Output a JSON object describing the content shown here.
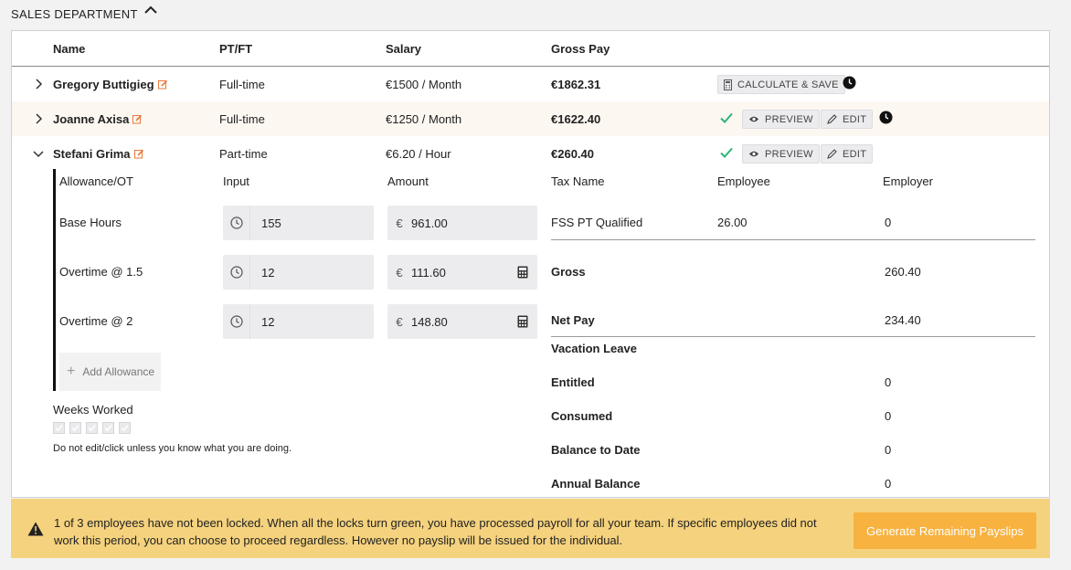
{
  "department": {
    "title": "SALES DEPARTMENT"
  },
  "table": {
    "headers": {
      "name": "Name",
      "type": "PT/FT",
      "salary": "Salary",
      "gross": "Gross Pay"
    },
    "rows": [
      {
        "name": "Gregory Buttigieg",
        "type": "Full-time",
        "salary": "€1500 / Month",
        "gross": "€1862.31",
        "action": "CALCULATE & SAVE"
      },
      {
        "name": "Joanne Axisa",
        "type": "Full-time",
        "salary": "€1250 / Month",
        "gross": "€1622.40",
        "preview": "PREVIEW",
        "edit": "EDIT"
      },
      {
        "name": "Stefani Grima",
        "type": "Part-time",
        "salary": "€6.20 / Hour",
        "gross": "€260.40",
        "preview": "PREVIEW",
        "edit": "EDIT"
      }
    ]
  },
  "detail": {
    "headers": {
      "allowance": "Allowance/OT",
      "input": "Input",
      "amount": "Amount",
      "tax_name": "Tax Name",
      "employee": "Employee",
      "employer": "Employer"
    },
    "allowances": [
      {
        "label": "Base Hours",
        "input": "155",
        "currency": "€",
        "amount": "961.00"
      },
      {
        "label": "Overtime @ 1.5",
        "input": "12",
        "currency": "€",
        "amount": "111.60"
      },
      {
        "label": "Overtime @ 2",
        "input": "12",
        "currency": "€",
        "amount": "148.80"
      }
    ],
    "add_allowance": "Add Allowance",
    "weeks_label": "Weeks Worked",
    "weeks_note": "Do not edit/click unless you know what you are doing.",
    "tax": {
      "name": "FSS PT Qualified",
      "employee": "26.00",
      "employer": "0"
    },
    "gross_label": "Gross",
    "gross_value": "260.40",
    "net_label": "Net Pay",
    "net_value": "234.40",
    "vacation_label": "Vacation Leave",
    "leave": [
      {
        "label": "Entitled",
        "value": "0"
      },
      {
        "label": "Consumed",
        "value": "0"
      },
      {
        "label": "Balance to Date",
        "value": "0"
      },
      {
        "label": "Annual Balance",
        "value": "0"
      }
    ]
  },
  "banner": {
    "message": "1 of 3 employees have not been locked. When all the locks turn green, you have processed payroll for all your team. If specific employees did not work this period, you can choose to proceed regardless. However no payslip will be issued for the individual.",
    "button": "Generate Remaining Payslips"
  },
  "colors": {
    "accent": "#f7b23f",
    "banner": "#f5d27e",
    "check": "#2bb673",
    "edit_icon": "#e8773a"
  }
}
